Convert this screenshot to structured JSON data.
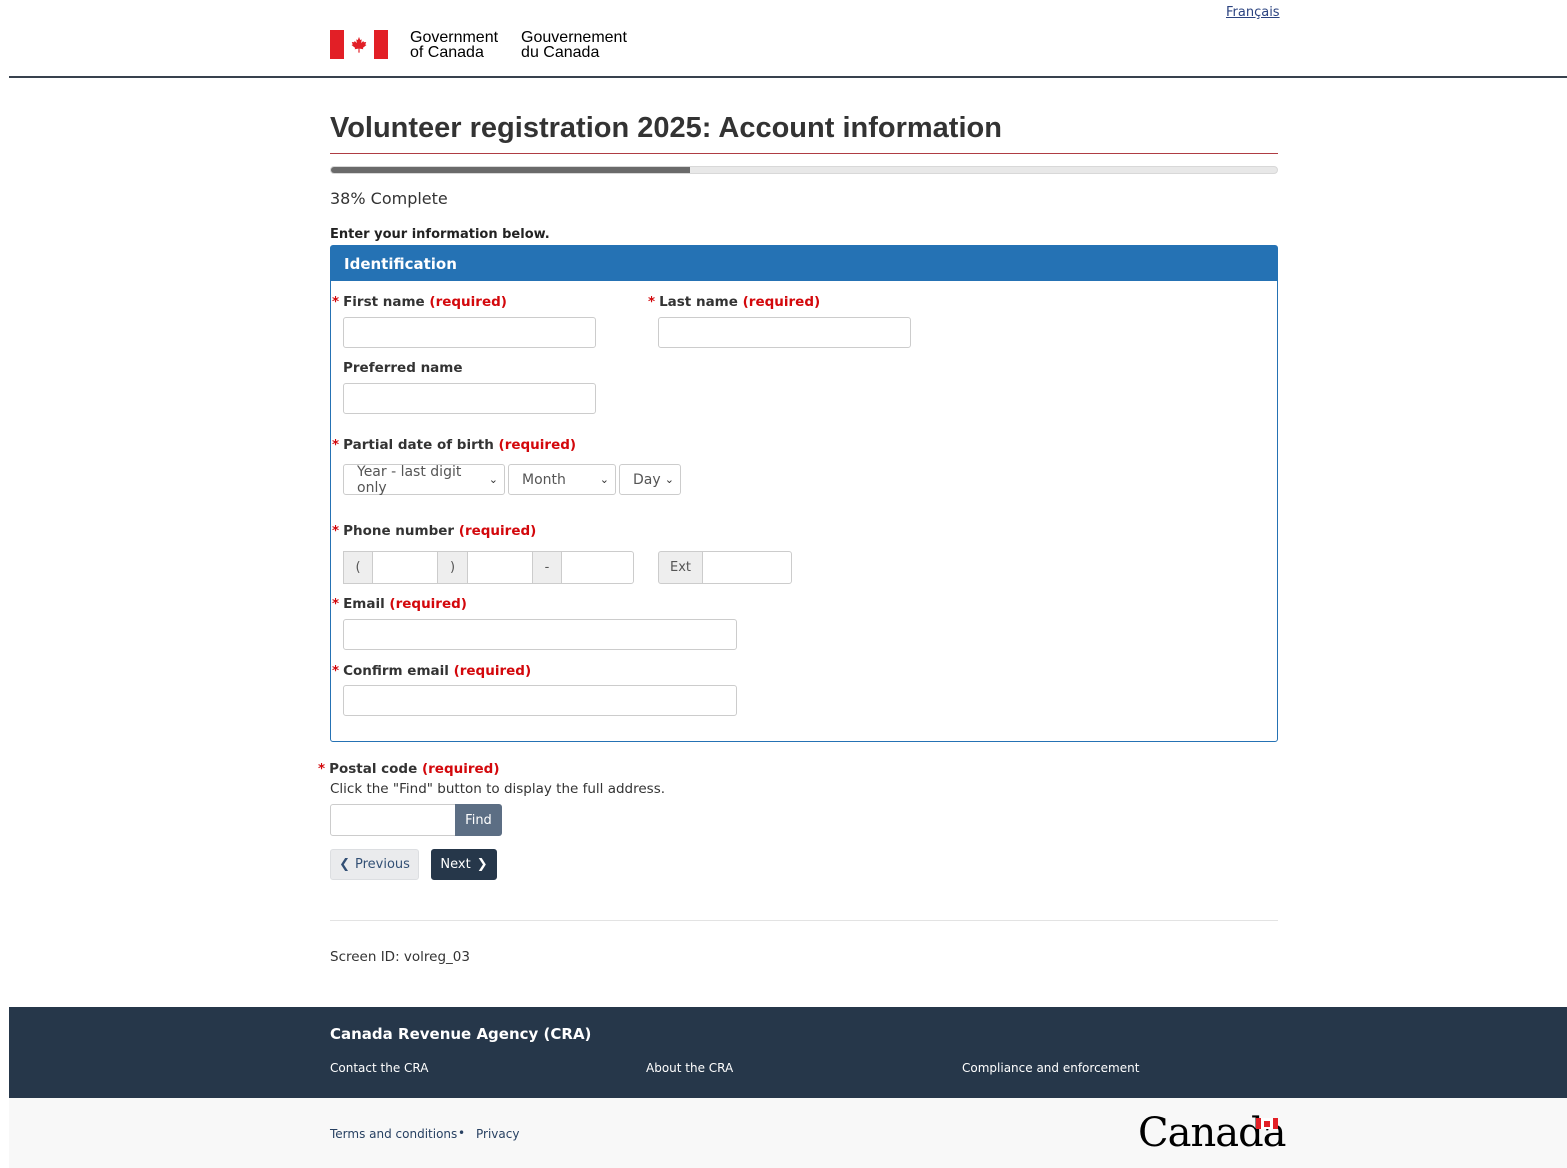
{
  "header": {
    "language_link": "Français",
    "signature_en_line1": "Government",
    "signature_en_line2": "of Canada",
    "signature_fr_line1": "Gouvernement",
    "signature_fr_line2": "du Canada"
  },
  "page": {
    "title": "Volunteer registration 2025: Account information",
    "progress_percent": 38,
    "progress_text": "38% Complete",
    "intro": "Enter your information below."
  },
  "identification": {
    "heading": "Identification",
    "required_marker": "*",
    "required_text": "(required)",
    "first_name_label": "First name",
    "first_name_value": "",
    "last_name_label": "Last name",
    "last_name_value": "",
    "preferred_name_label": "Preferred name",
    "preferred_name_value": "",
    "dob_label": "Partial date of birth",
    "dob_year": "Year - last digit only",
    "dob_month": "Month",
    "dob_day": "Day",
    "phone_label": "Phone number",
    "phone_open": "(",
    "phone_close": ")",
    "phone_dash": "-",
    "phone_ext": "Ext",
    "email_label": "Email",
    "email_value": "",
    "confirm_email_label": "Confirm email",
    "confirm_email_value": ""
  },
  "postal": {
    "label": "Postal code",
    "help": "Click the \"Find\" button to display the full address.",
    "value": "",
    "find_button": "Find"
  },
  "nav": {
    "previous": "Previous",
    "next": "Next"
  },
  "screen_id": "Screen ID: volreg_03",
  "footer": {
    "title": "Canada Revenue Agency (CRA)",
    "links": [
      "Contact the CRA",
      "About the CRA",
      "Compliance and enforcement"
    ],
    "terms": "Terms and conditions",
    "separator": "•",
    "privacy": "Privacy",
    "wordmark": "Canada"
  },
  "colors": {
    "gc_red": "#e21f26",
    "panel_blue": "#2572b4",
    "footer_navy": "#26374a",
    "required_red": "#d3080c"
  }
}
